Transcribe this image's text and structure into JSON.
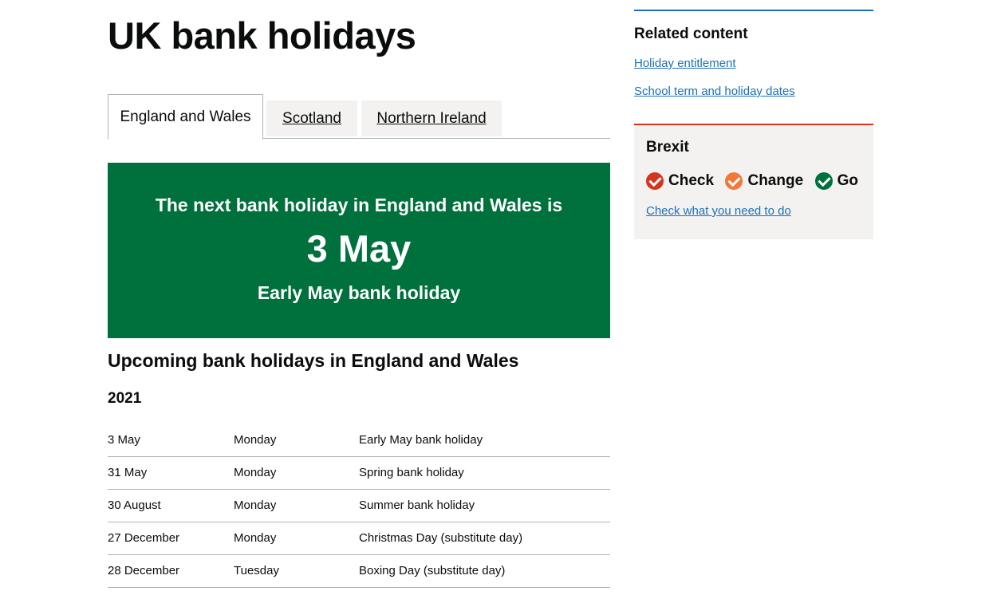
{
  "page": {
    "title": "UK bank holidays"
  },
  "tabs": [
    {
      "label": "England and Wales",
      "active": true
    },
    {
      "label": "Scotland",
      "active": false
    },
    {
      "label": "Northern Ireland",
      "active": false
    }
  ],
  "next_holiday": {
    "intro": "The next bank holiday in England and Wales is",
    "date": "3 May",
    "name": "Early May bank holiday"
  },
  "upcoming": {
    "heading": "Upcoming bank holidays in England and Wales",
    "year": "2021",
    "rows": [
      {
        "date": "3 May",
        "day": "Monday",
        "holiday": "Early May bank holiday"
      },
      {
        "date": "31 May",
        "day": "Monday",
        "holiday": "Spring bank holiday"
      },
      {
        "date": "30 August",
        "day": "Monday",
        "holiday": "Summer bank holiday"
      },
      {
        "date": "27 December",
        "day": "Monday",
        "holiday": "Christmas Day (substitute day)"
      },
      {
        "date": "28 December",
        "day": "Tuesday",
        "holiday": "Boxing Day (substitute day)"
      }
    ]
  },
  "related": {
    "title": "Related content",
    "links": [
      "Holiday entitlement",
      "School term and holiday dates"
    ]
  },
  "brexit": {
    "title": "Brexit",
    "slogan": [
      {
        "word": "Check",
        "color": "#d4351c"
      },
      {
        "word": "Change",
        "color": "#f47738"
      },
      {
        "word": "Go",
        "color": "#00703c"
      }
    ],
    "link": "Check what you need to do"
  },
  "colors": {
    "panel": "#00703c",
    "link": "#1d70b8",
    "brexit_border": "#d4351c"
  }
}
